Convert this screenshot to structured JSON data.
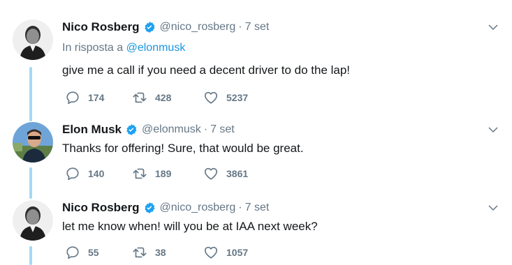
{
  "tweets": [
    {
      "name": "Nico Rosberg",
      "handle": "@nico_rosberg",
      "dot": "·",
      "time": "7 set",
      "reply_prefix": "In risposta a",
      "reply_handle": "@elonmusk",
      "text": "give me a call if you need a decent driver to do the lap!",
      "replies": "174",
      "retweets": "428",
      "likes": "5237"
    },
    {
      "name": "Elon Musk",
      "handle": "@elonmusk",
      "dot": "·",
      "time": "7 set",
      "text": "Thanks for offering! Sure, that would be great.",
      "replies": "140",
      "retweets": "189",
      "likes": "3861"
    },
    {
      "name": "Nico Rosberg",
      "handle": "@nico_rosberg",
      "dot": "·",
      "time": "7 set",
      "text": "let me know when! will you be at IAA next week?",
      "replies": "55",
      "retweets": "38",
      "likes": "1057"
    }
  ],
  "icons": {
    "verified": "verified-badge-icon",
    "reply": "reply-icon",
    "retweet": "retweet-icon",
    "like": "heart-icon",
    "menu": "chevron-down-icon"
  },
  "colors": {
    "accent": "#1da1f2",
    "link": "#1b95e0",
    "thread_line": "#a2daf5",
    "muted": "#657786",
    "text": "#14171a"
  }
}
